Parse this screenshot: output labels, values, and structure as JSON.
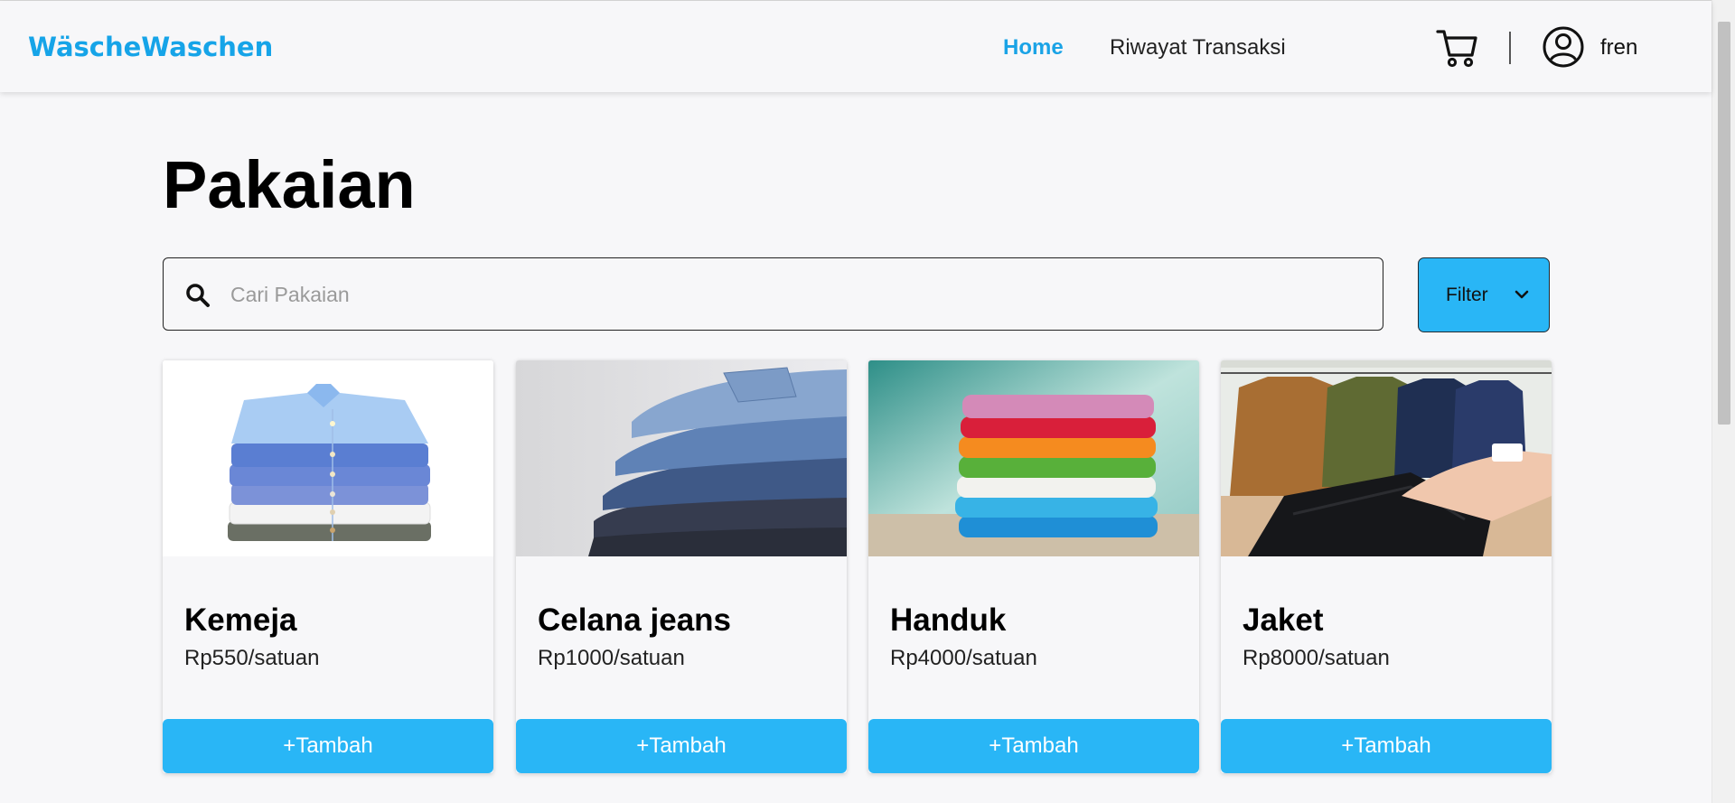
{
  "navbar": {
    "brand": "WäscheWaschen",
    "links": [
      {
        "label": "Home",
        "active": true
      },
      {
        "label": "Riwayat Transaksi",
        "active": false
      }
    ],
    "cart_icon": "cart-icon",
    "user_icon": "user-circle-icon",
    "username": "fren"
  },
  "main": {
    "title": "Pakaian",
    "search": {
      "placeholder": "Cari Pakaian",
      "value": "",
      "icon": "search-icon"
    },
    "filter": {
      "label": "Filter",
      "icon": "chevron-down-icon"
    },
    "products": [
      {
        "name": "Kemeja",
        "price": "Rp550/satuan",
        "button": "+Tambah",
        "image": "stack of folded shirts"
      },
      {
        "name": "Celana jeans",
        "price": "Rp1000/satuan",
        "button": "+Tambah",
        "image": "stack of folded jeans"
      },
      {
        "name": "Handuk",
        "price": "Rp4000/satuan",
        "button": "+Tambah",
        "image": "stack of colorful towels"
      },
      {
        "name": "Jaket",
        "price": "Rp8000/satuan",
        "button": "+Tambah",
        "image": "jackets on rack"
      }
    ]
  },
  "colors": {
    "accent": "#29b6f6",
    "brand": "#16a4e8",
    "background": "#f7f7f9"
  }
}
